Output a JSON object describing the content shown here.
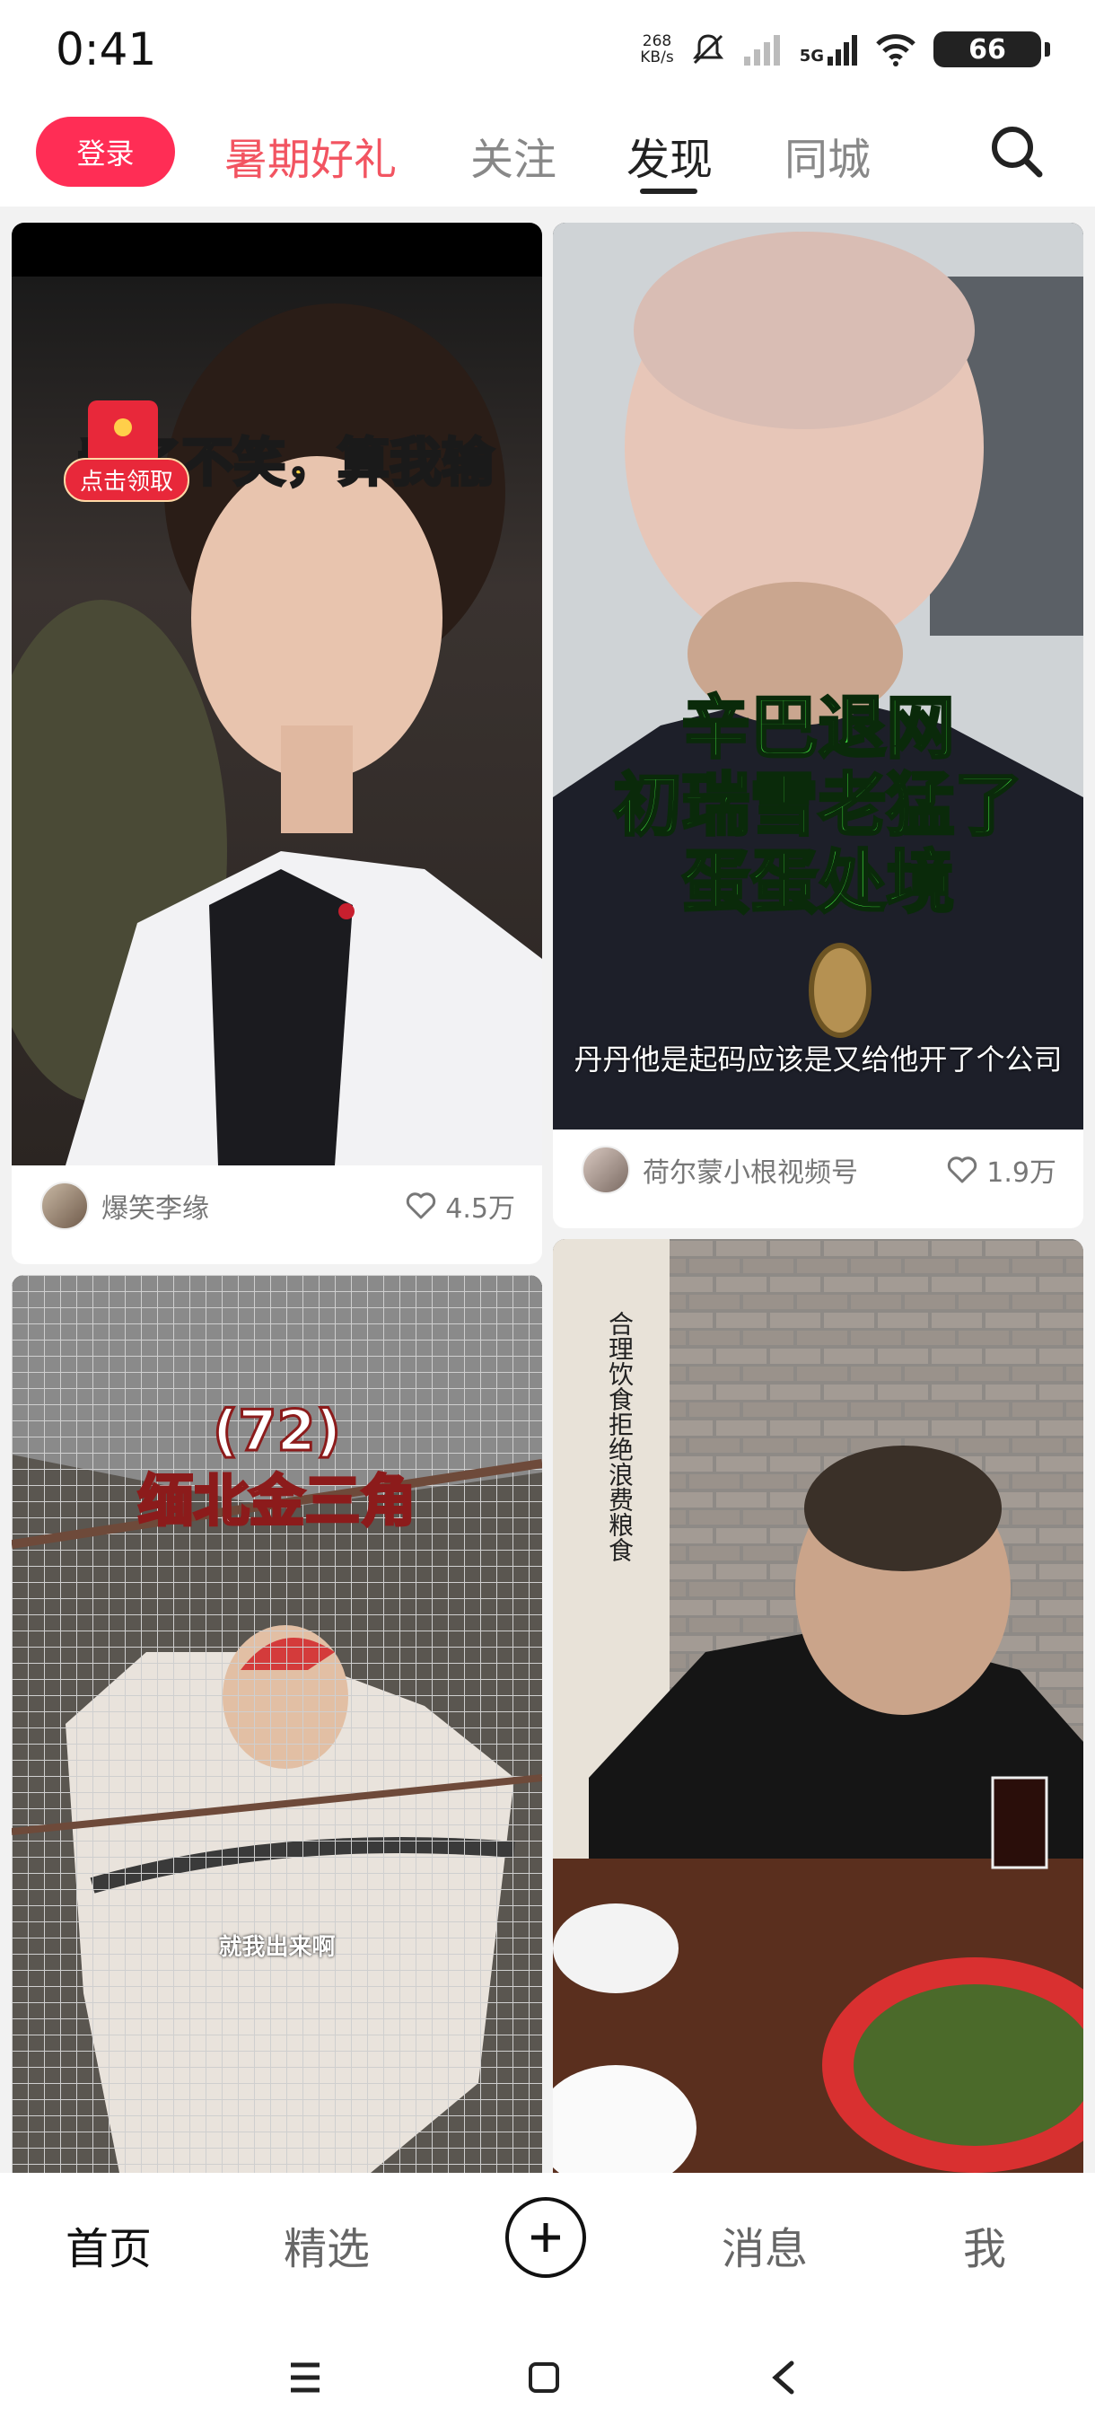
{
  "status": {
    "time": "0:41",
    "net_speed": "268",
    "net_unit": "KB/s",
    "network": "5G",
    "battery": "66"
  },
  "topnav": {
    "login": "登录",
    "tabs": [
      "暑期好礼",
      "关注",
      "发现",
      "同城"
    ],
    "active_tab": "发现"
  },
  "feed": [
    {
      "overlay": "看了不笑，算我输",
      "badge": "点击领取",
      "author": "爆笑李缘",
      "likes": "4.5万"
    },
    {
      "overlay_lines": [
        "辛巴退网",
        "初瑞雪老猛了",
        "蛋蛋处境"
      ],
      "caption": "丹丹他是起码应该是又给他开了个公司",
      "author": "荷尔蒙小根视频号",
      "likes": "1.9万"
    },
    {
      "overlay_lines": [
        "(72)",
        "缅北金三角"
      ],
      "subtitle": "就我出来啊"
    },
    {
      "sign": "合理饮食拒绝浪费粮食"
    }
  ],
  "bottomnav": {
    "items": [
      "首页",
      "精选",
      "消息",
      "我"
    ],
    "active": "首页"
  },
  "colors": {
    "accent": "#ff2d55",
    "promo": "#f25461"
  }
}
